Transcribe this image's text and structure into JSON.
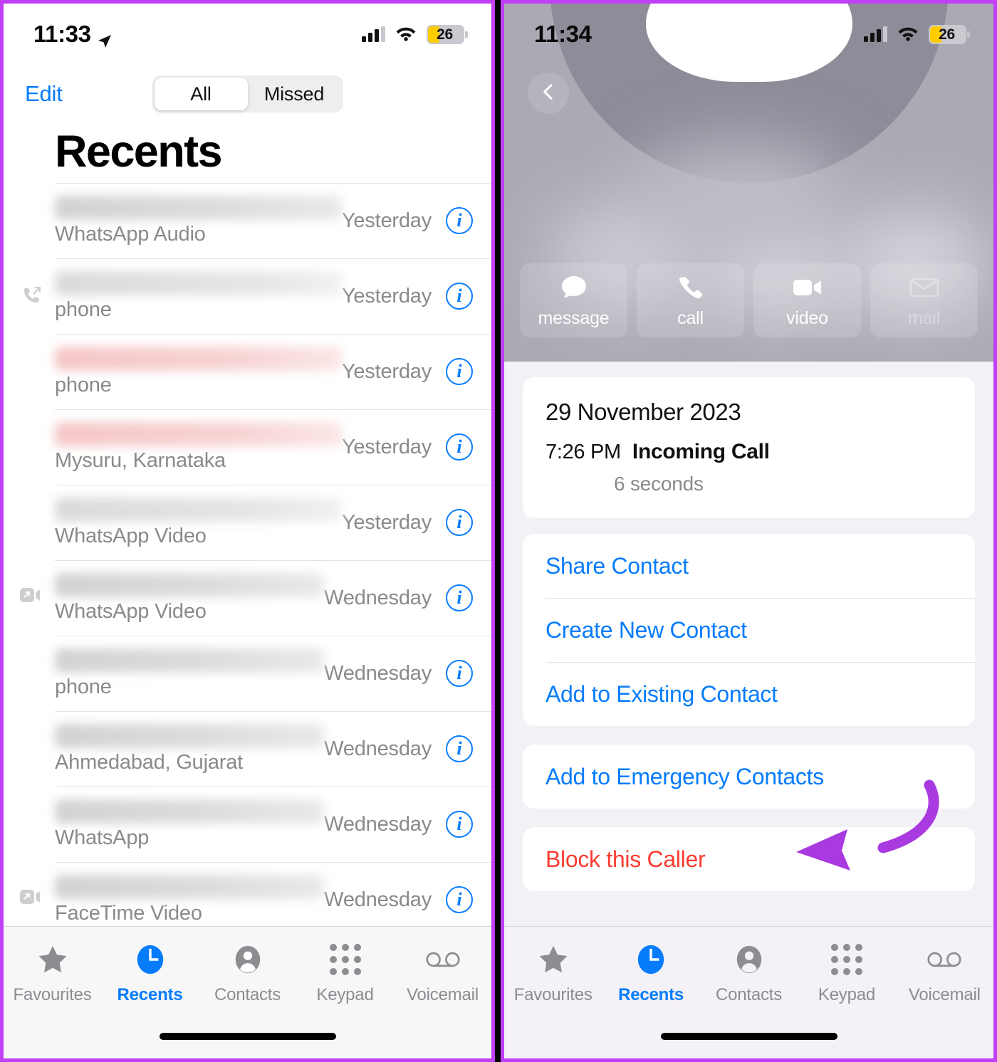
{
  "accent_colors": {
    "ios_blue": "#067cfd",
    "destructive_red": "#fb3b30",
    "annotation_purple": "#a93ae0",
    "frame_purple": "#c13ff5",
    "battery_yellow": "#ffcc00"
  },
  "left_phone": {
    "status_bar": {
      "time": "11:33",
      "location_icon": "location-arrow-icon",
      "cellular_icon": "cellular-bars-icon",
      "wifi_icon": "wifi-icon",
      "battery_percent": "26"
    },
    "nav": {
      "edit_label": "Edit",
      "segments": [
        {
          "label": "All",
          "selected": true
        },
        {
          "label": "Missed",
          "selected": false
        }
      ]
    },
    "page_title": "Recents",
    "calls": [
      {
        "name_redacted": true,
        "redact_style": "grey",
        "subtitle": "WhatsApp Audio",
        "when": "Yesterday",
        "call_type_icon": ""
      },
      {
        "name_redacted": true,
        "redact_style": "ghost",
        "subtitle": "phone",
        "when": "Yesterday",
        "call_type_icon": "outgoing-call-icon"
      },
      {
        "name_redacted": true,
        "redact_style": "pink",
        "subtitle": "phone",
        "when": "Yesterday",
        "call_type_icon": ""
      },
      {
        "name_redacted": true,
        "redact_style": "pink",
        "subtitle": "Mysuru, Karnataka",
        "when": "Yesterday",
        "call_type_icon": ""
      },
      {
        "name_redacted": true,
        "redact_style": "ghost",
        "subtitle": "WhatsApp Video",
        "when": "Yesterday",
        "call_type_icon": ""
      },
      {
        "name_redacted": true,
        "redact_style": "grey",
        "subtitle": "WhatsApp Video",
        "when": "Wednesday",
        "call_type_icon": "outgoing-video-icon"
      },
      {
        "name_redacted": true,
        "redact_style": "grey",
        "subtitle": "phone",
        "when": "Wednesday",
        "call_type_icon": ""
      },
      {
        "name_redacted": true,
        "redact_style": "grey",
        "subtitle": "Ahmedabad, Gujarat",
        "when": "Wednesday",
        "call_type_icon": ""
      },
      {
        "name_redacted": true,
        "redact_style": "grey",
        "subtitle": "WhatsApp",
        "when": "Wednesday",
        "call_type_icon": ""
      },
      {
        "name_redacted": true,
        "redact_style": "grey",
        "subtitle": "FaceTime Video",
        "when": "Wednesday",
        "call_type_icon": "outgoing-video-icon"
      }
    ],
    "info_button_glyph": "i",
    "tabs": [
      {
        "label": "Favourites",
        "icon": "star-icon",
        "active": false
      },
      {
        "label": "Recents",
        "icon": "clock-icon",
        "active": true
      },
      {
        "label": "Contacts",
        "icon": "person-icon",
        "active": false
      },
      {
        "label": "Keypad",
        "icon": "keypad-icon",
        "active": false
      },
      {
        "label": "Voicemail",
        "icon": "voicemail-icon",
        "active": false
      }
    ]
  },
  "right_phone": {
    "status_bar": {
      "time": "11:34",
      "cellular_icon": "cellular-bars-icon",
      "wifi_icon": "wifi-icon",
      "battery_percent": "26"
    },
    "back_button_icon": "chevron-left-icon",
    "quick_actions": [
      {
        "label": "message",
        "icon": "message-bubble-icon",
        "disabled": false
      },
      {
        "label": "call",
        "icon": "phone-handset-icon",
        "disabled": false
      },
      {
        "label": "video",
        "icon": "video-camera-icon",
        "disabled": false
      },
      {
        "label": "mail",
        "icon": "envelope-icon",
        "disabled": true
      }
    ],
    "call_info": {
      "date": "29 November 2023",
      "time": "7:26 PM",
      "type": "Incoming Call",
      "duration": "6 seconds"
    },
    "contact_actions": [
      {
        "label": "Share Contact",
        "style": "blue"
      },
      {
        "label": "Create New Contact",
        "style": "blue"
      },
      {
        "label": "Add to Existing Contact",
        "style": "blue"
      }
    ],
    "emergency_actions": [
      {
        "label": "Add to Emergency Contacts",
        "style": "blue"
      }
    ],
    "block_actions": [
      {
        "label": "Block this Caller",
        "style": "red"
      }
    ],
    "tabs": [
      {
        "label": "Favourites",
        "icon": "star-icon",
        "active": false
      },
      {
        "label": "Recents",
        "icon": "clock-icon",
        "active": true
      },
      {
        "label": "Contacts",
        "icon": "person-icon",
        "active": false
      },
      {
        "label": "Keypad",
        "icon": "keypad-icon",
        "active": false
      },
      {
        "label": "Voicemail",
        "icon": "voicemail-icon",
        "active": false
      }
    ]
  },
  "annotation": {
    "type": "curved-arrow",
    "points_to": "Block this Caller",
    "color": "#a93ae0"
  }
}
